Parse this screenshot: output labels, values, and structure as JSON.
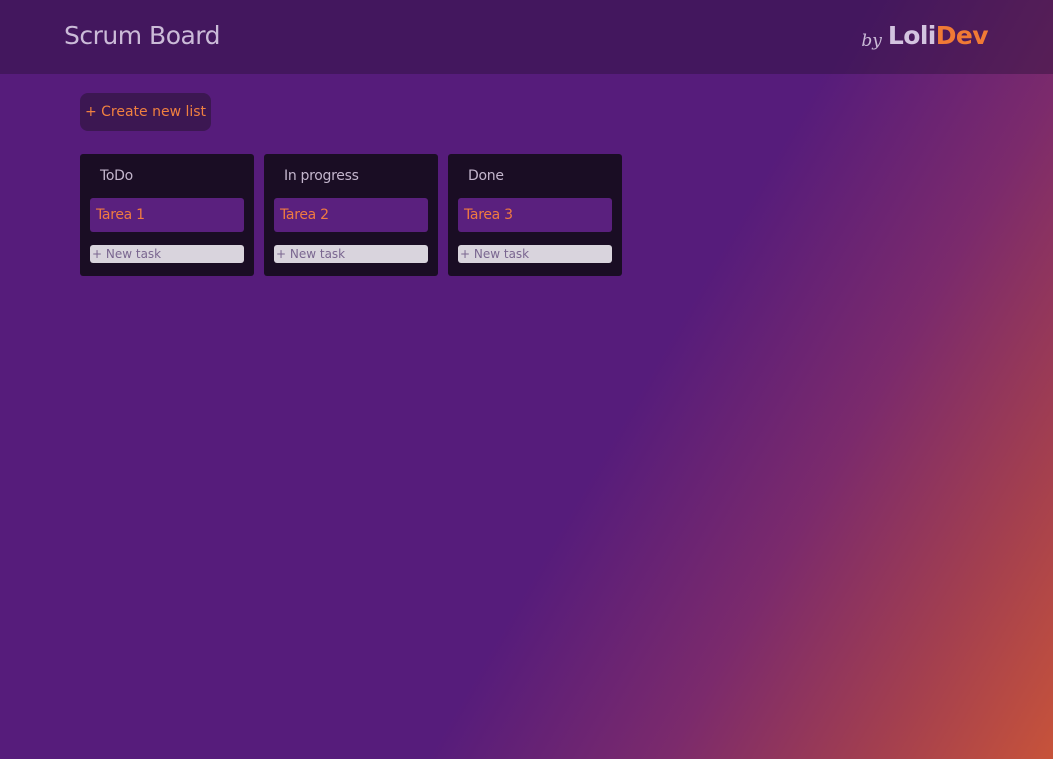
{
  "header": {
    "title": "Scrum Board",
    "brand": {
      "by": "by",
      "name_part1": "Loli",
      "name_part2": "Dev"
    }
  },
  "toolbar": {
    "create_list_label": "+ Create new list"
  },
  "lists": [
    {
      "title": "ToDo",
      "tasks": [
        "Tarea 1"
      ],
      "new_task_placeholder": "+ New task"
    },
    {
      "title": "In progress",
      "tasks": [
        "Tarea 2"
      ],
      "new_task_placeholder": "+ New task"
    },
    {
      "title": "Done",
      "tasks": [
        "Tarea 3"
      ],
      "new_task_placeholder": "+ New task"
    }
  ],
  "colors": {
    "accent": "#f07a35",
    "background": "#561c7b",
    "list_background": "#1a0d24",
    "task_background": "#5a207e"
  }
}
